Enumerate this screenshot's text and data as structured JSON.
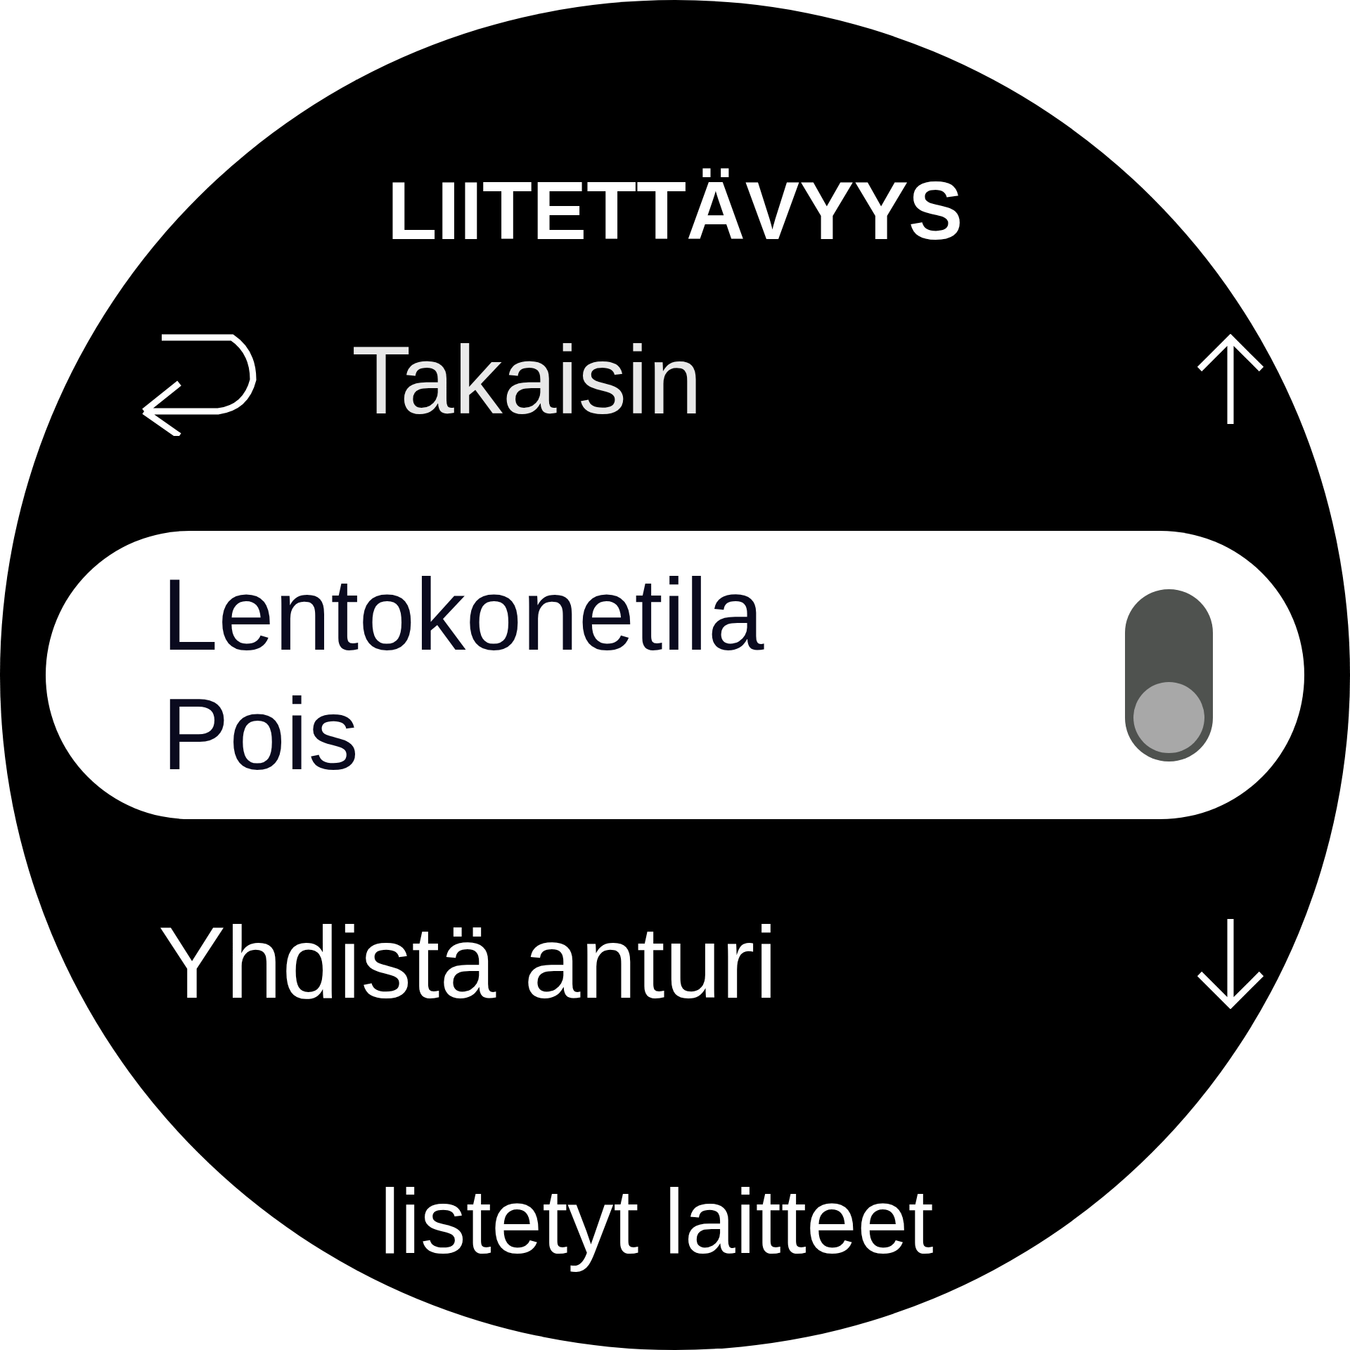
{
  "title": "LIITETTÄVYYS",
  "back": {
    "label": "Takaisin"
  },
  "items": [
    {
      "kind": "toggle",
      "label": "Lentokonetila",
      "value": "Pois",
      "on": false,
      "selected": true
    },
    {
      "kind": "link",
      "label": "Yhdistä anturi",
      "selected": false
    },
    {
      "kind": "link",
      "label": "listetyt laitteet",
      "selected": false
    }
  ]
}
